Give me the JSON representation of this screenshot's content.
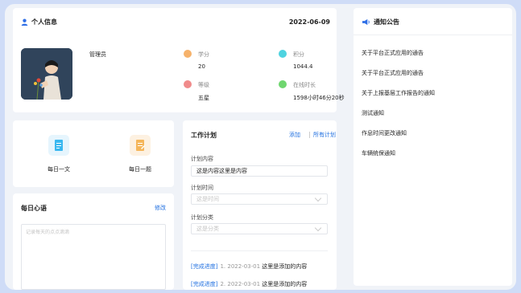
{
  "profile": {
    "title": "个人信息",
    "date": "2022-06-09",
    "name": "管理员",
    "stats": [
      {
        "label": "学分",
        "value": "20",
        "color": "#f6b26b"
      },
      {
        "label": "积分",
        "value": "1044.4",
        "color": "#4fd3e0"
      },
      {
        "label": "等级",
        "value": "五星",
        "color": "#f08b8b"
      },
      {
        "label": "在线时长",
        "value": "1598小时46分20秒",
        "color": "#6fd66f"
      }
    ]
  },
  "notice": {
    "title": "通知公告",
    "items": [
      "关于平台正式应用的通告",
      "关于平台正式应用的通告",
      "关于上报基层工作报告的通知",
      "测试通知",
      "作息时间更改通知",
      "车辆统保通知"
    ]
  },
  "quick": {
    "items": [
      {
        "label": "每日一文",
        "icon": "article-icon",
        "color": "#3ab8f0",
        "bg": "#e6f5fd"
      },
      {
        "label": "每日一题",
        "icon": "question-icon",
        "color": "#f5b65a",
        "bg": "#fdf1e1"
      }
    ]
  },
  "mood": {
    "title": "每日心语",
    "edit": "修改",
    "placeholder": "记录每天的点点滴滴"
  },
  "plan": {
    "title": "工作计划",
    "add": "添加",
    "all": "所有计划",
    "content_label": "计划内容",
    "content_value": "这是内容这里是内容",
    "time_label": "计划时间",
    "time_placeholder": "这是时间",
    "category_label": "计划分类",
    "category_placeholder": "这是分类",
    "progress": [
      {
        "tag": "[完成进度]",
        "meta": "1. 2022-03-01",
        "text": "这里是添加的内容"
      },
      {
        "tag": "[完成进度]",
        "meta": "2. 2022-03-01",
        "text": "这里是添加的内容"
      }
    ]
  }
}
